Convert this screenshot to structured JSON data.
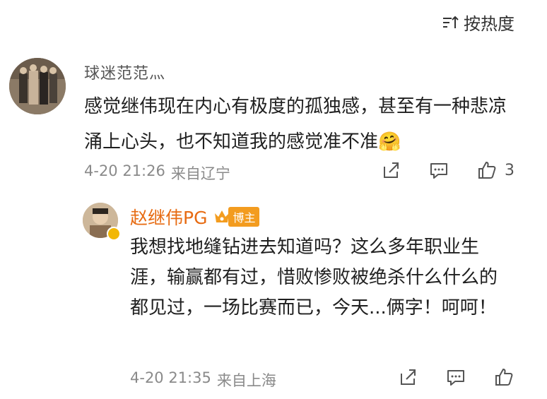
{
  "sort": {
    "label": "按热度",
    "icon": "sort-icon"
  },
  "comment": {
    "username": "球迷范范灬",
    "content": "感觉继伟现在内心有极度的孤独感，甚至有一种悲凉涌上心头，也不知道我的感觉准不准🤗",
    "time": "4-20 21:26",
    "location": "来自辽宁",
    "likes": "3",
    "icons": [
      "share-icon",
      "comment-icon",
      "like-icon"
    ]
  },
  "reply": {
    "username": "赵继伟PG",
    "badge": "博主",
    "content": "我想找地缝钻进去知道吗？这么多年职业生涯，输赢都有过，惜败惨败被绝杀什么什么的都见过，一场比赛而已，今天...俩字！呵呵！",
    "time": "4-20 21:35",
    "location": "来自上海",
    "icons": [
      "share-icon",
      "comment-icon",
      "like-icon"
    ]
  },
  "colors": {
    "accent": "#e76b12",
    "meta": "#8a8a8a",
    "badge": "#f39c1f"
  }
}
